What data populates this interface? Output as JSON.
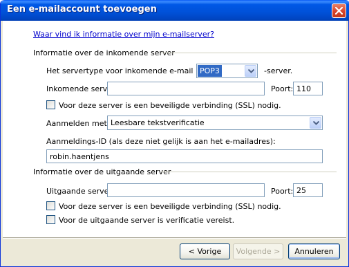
{
  "window": {
    "title": "Een e-mailaccount toevoegen"
  },
  "help_link": "Waar vind ik informatie over mijn e-mailserver?",
  "incoming": {
    "section_title": "Informatie over de inkomende server",
    "servertype_label": "Het servertype voor inkomende e-mail is een",
    "servertype_value": "POP3",
    "servertype_suffix": "-server.",
    "server_label": "Inkomende server:",
    "server_value": "",
    "port_label": "Poort:",
    "port_value": "110",
    "ssl_label": "Voor deze server is een beveiligde verbinding (SSL) nodig.",
    "login_label": "Aanmelden met:",
    "login_value": "Leesbare tekstverificatie",
    "login_id_label": "Aanmeldings-ID (als deze niet gelijk is aan het e-mailadres):",
    "login_id_value": "robin.haentjens"
  },
  "outgoing": {
    "section_title": "Informatie over de uitgaande server",
    "server_label": "Uitgaande server:",
    "server_value": "",
    "port_label": "Poort:",
    "port_value": "25",
    "ssl_label": "Voor deze server is een beveiligde verbinding (SSL) nodig.",
    "auth_label": "Voor de uitgaande server is verificatie vereist."
  },
  "buttons": {
    "back": "< Vorige",
    "next": "Volgende >",
    "cancel": "Annuleren"
  },
  "icons": {
    "close": "close-icon",
    "dropdown": "chevron-down-icon"
  },
  "colors": {
    "titlebar": "#0058e6",
    "dialog_bg": "#ece9d8",
    "link": "#0000cc",
    "selection": "#316ac5",
    "close_button": "#d8422a"
  }
}
